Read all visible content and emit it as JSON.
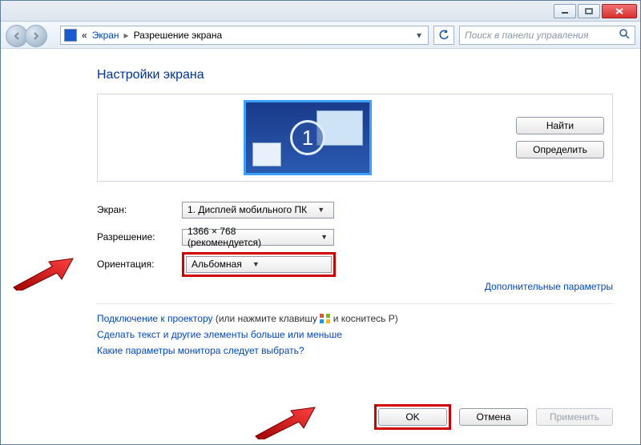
{
  "breadcrumb": {
    "root_marker": "«",
    "item1": "Экран",
    "item2": "Разрешение экрана"
  },
  "search": {
    "placeholder": "Поиск в панели управления"
  },
  "heading": "Настройки экрана",
  "monitor_badge": "1",
  "buttons": {
    "find": "Найти",
    "detect": "Определить",
    "ok": "OK",
    "cancel": "Отмена",
    "apply": "Применить"
  },
  "rows": {
    "display_label": "Экран:",
    "display_value": "1. Дисплей мобильного ПК",
    "resolution_label": "Разрешение:",
    "resolution_value": "1366 × 768 (рекомендуется)",
    "orientation_label": "Ориентация:",
    "orientation_value": "Альбомная"
  },
  "advanced_link": "Дополнительные параметры",
  "links": {
    "projector_a": "Подключение к проектору",
    "projector_b": " (или нажмите клавишу ",
    "projector_c": " и коснитесь P)",
    "scaling": "Сделать текст и другие элементы больше или меньше",
    "which": "Какие параметры монитора следует выбрать?"
  }
}
